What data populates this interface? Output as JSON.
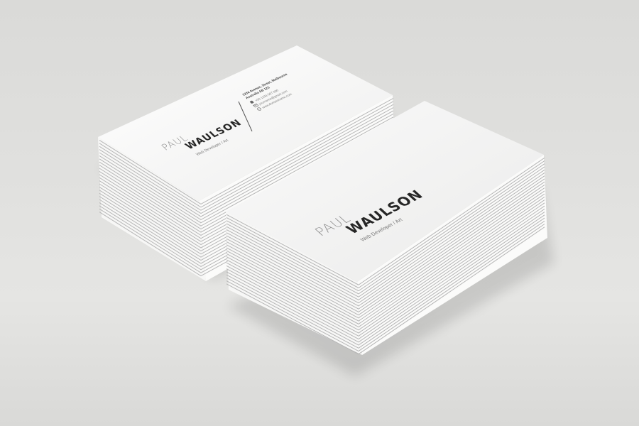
{
  "card_front": {
    "first_name": "PAUL",
    "last_name": "WAULSON",
    "role": "Web Developer / Art"
  },
  "card_back": {
    "first_name": "PAUL",
    "last_name": "WAULSON",
    "role": "Web Developer / Art",
    "address_line1": "1234 Avenue, Street, Melbourne",
    "address_line2": "Australia AB 123",
    "phone": "+00 1234 567 890",
    "email": "yourname@gmail.com",
    "website": "www.domainname.com",
    "icons": [
      "phone-icon",
      "email-icon",
      "globe-icon"
    ]
  },
  "colors": {
    "card_face": "#f4f4f3",
    "card_edge": "#ffffff",
    "edge_line": "#b9b9b9",
    "name_dark": "#262626",
    "name_light": "#8c8c8c"
  }
}
